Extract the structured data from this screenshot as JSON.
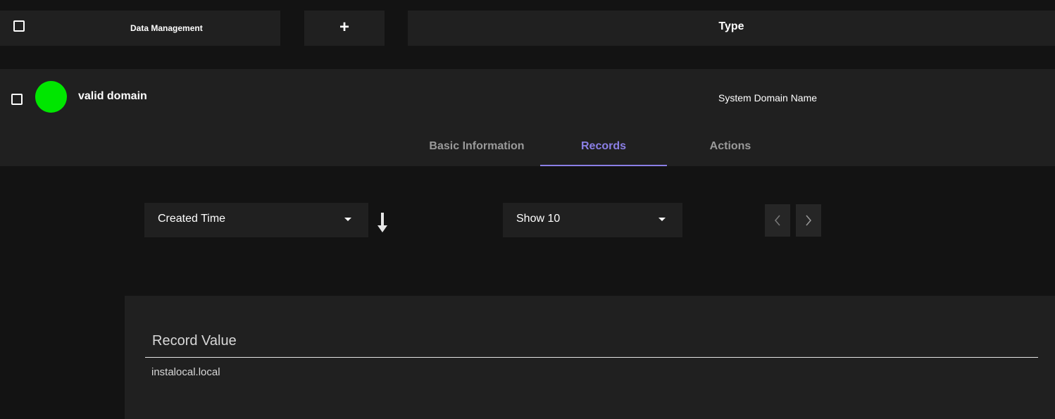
{
  "header": {
    "title": "Data Management",
    "add_icon": "+",
    "type_label": "Type"
  },
  "domain": {
    "name": "valid domain",
    "type": "System Domain Name",
    "status_color": "#00e600"
  },
  "tabs": [
    {
      "label": "Basic Information",
      "active": false
    },
    {
      "label": "Records",
      "active": true
    },
    {
      "label": "Actions",
      "active": false
    }
  ],
  "controls": {
    "sort_by": "Created Time",
    "sort_direction_icon": "arrow-down-icon",
    "page_size": "Show 10",
    "prev_icon": "chevron-left-icon",
    "next_icon": "chevron-right-icon"
  },
  "records": {
    "column": "Record Value",
    "rows": [
      "instalocal.local"
    ]
  },
  "colors": {
    "accent": "#8b7fe6",
    "panel": "#202020",
    "background": "#131313"
  }
}
